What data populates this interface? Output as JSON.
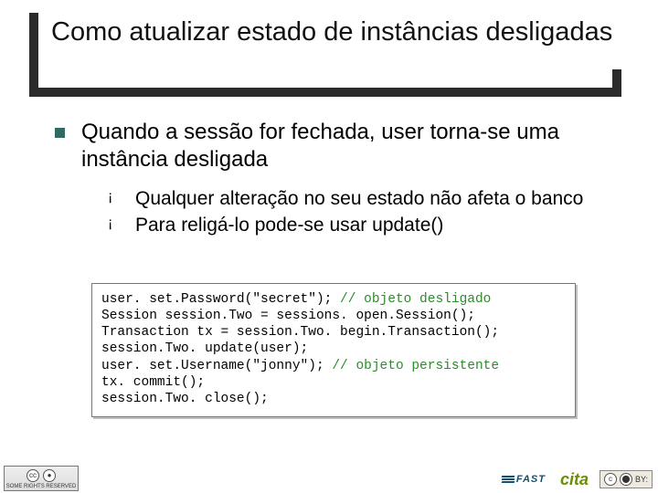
{
  "title": "Como atualizar estado de instâncias desligadas",
  "bullets": {
    "lvl1": "Quando a sessão for fechada, user torna-se uma instância desligada",
    "lvl2": [
      "Qualquer alteração no seu estado não afeta o banco",
      "Para religá-lo pode-se usar update()"
    ]
  },
  "code": {
    "l1a": "user. set.Password(\"secret\"); ",
    "l1c": "// objeto desligado",
    "l2": "Session session.Two = sessions. open.Session();",
    "l3": "Transaction tx = session.Two. begin.Transaction();",
    "l4": "session.Two. update(user);",
    "l5a": "user. set.Username(\"jonny\"); ",
    "l5c": "// objeto persistente",
    "l6": "tx. commit();",
    "l7": "session.Two. close();"
  },
  "footer": {
    "cc_text": "SOME RIGHTS RESERVED",
    "fast": "FAST",
    "cita": "cita",
    "by": "BY:"
  }
}
